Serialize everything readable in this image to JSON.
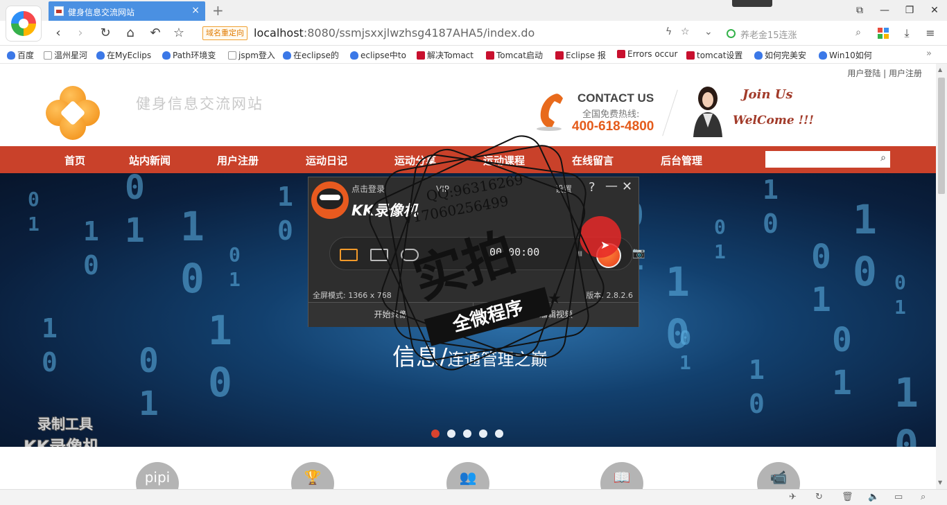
{
  "browser": {
    "tab_title": "健身信息交流网站",
    "tab_close": "×",
    "new_tab": "+",
    "window_controls": [
      "⧉",
      "—",
      "❐",
      "✕"
    ],
    "address_badge": "域名重定向",
    "url_host": "localhost",
    "url_rest": ":8080/ssmjsxxjlwzhsg4187AHA5/index.do",
    "search_placeholder": "养老金15连涨",
    "nav": {
      "back": "‹",
      "forward": "›",
      "reload": "↻",
      "home": "⌂",
      "undo": "↶",
      "star": "☆"
    },
    "address_icons": {
      "lightning": "ϟ",
      "fav": "☆",
      "dropdown": "⌄"
    },
    "bookmarks": [
      {
        "label": "百度",
        "icon": "paw"
      },
      {
        "label": "温州星河",
        "icon": "doc"
      },
      {
        "label": "在MyEclips",
        "icon": "paw"
      },
      {
        "label": "Path环境变",
        "icon": "paw"
      },
      {
        "label": "jspm登入",
        "icon": "doc"
      },
      {
        "label": "在eclipse的",
        "icon": "paw"
      },
      {
        "label": "eclipse中to",
        "icon": "paw"
      },
      {
        "label": "解决Tomact",
        "icon": "red"
      },
      {
        "label": "Tomcat启动",
        "icon": "red"
      },
      {
        "label": "Eclipse 报",
        "icon": "red"
      },
      {
        "label": "Errors occur",
        "icon": "red"
      },
      {
        "label": "tomcat设置",
        "icon": "red"
      },
      {
        "label": "如何完美安",
        "icon": "paw"
      },
      {
        "label": "Win10如何",
        "icon": "paw"
      }
    ],
    "bookmarks_more": "»"
  },
  "site": {
    "user_links": "用户登陆 | 用户注册",
    "title": "健身信息交流网站",
    "contact_title": "CONTACT US",
    "contact_sub": "全国免费热线:",
    "contact_phone": "400-618-4800",
    "join_us": "Join Us",
    "welcome": "WelCome !!!",
    "nav": [
      "首页",
      "站内新闻",
      "用户注册",
      "运动日记",
      "运动分享",
      "运动课程",
      "在线留言",
      "后台管理"
    ],
    "banner_caption_big": "信息/",
    "banner_caption_small": "连通管理之巅",
    "banner_dots": 5,
    "banner_active_dot": 0,
    "record_watermark_1": "录制工具",
    "record_watermark_2": "KK录像机",
    "feature_icons": [
      "pipi",
      "🏆",
      "👥",
      "📖",
      "📹"
    ]
  },
  "recorder": {
    "login": "点击登录",
    "vip": "VIP",
    "settings": "设置",
    "help": "?",
    "minimize": "—",
    "close": "✕",
    "brand": "KK录像机",
    "timer": "00:00:00",
    "pause": "⏸",
    "camera": "📷",
    "full_mode": "全屏模式: 1366 x 768",
    "version": "版本: 2.8.2.6",
    "left_button": "开始录像",
    "right_button": "编辑视频"
  },
  "stamp": {
    "qq": "QQ:96316269",
    "vx": "V17060256499",
    "big": "实拍",
    "ribbon": "全微程序",
    "star": "★"
  },
  "colors": {
    "nav_red": "#c9412a",
    "accent_orange": "#e45b1b",
    "tab_blue": "#4a90e2"
  }
}
